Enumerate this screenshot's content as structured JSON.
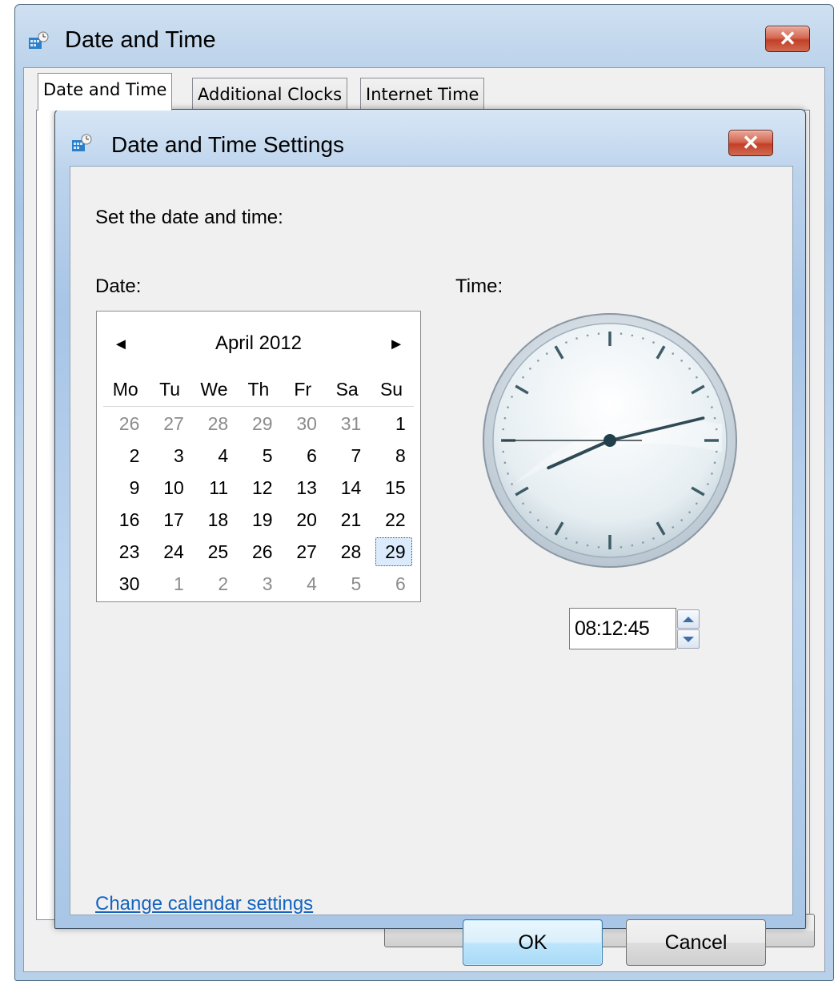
{
  "outer_window": {
    "title": "Date and Time",
    "tabs": [
      "Date and Time",
      "Additional Clocks",
      "Internet Time"
    ]
  },
  "dialog": {
    "title": "Date and Time Settings",
    "prompt": "Set the date and time:",
    "date_label": "Date:",
    "time_label": "Time:",
    "calendar": {
      "month_year": "April 2012",
      "prev_arrow": "◄",
      "next_arrow": "►",
      "weekdays": [
        "Mo",
        "Tu",
        "We",
        "Th",
        "Fr",
        "Sa",
        "Su"
      ],
      "days": [
        {
          "d": "26",
          "other": true
        },
        {
          "d": "27",
          "other": true
        },
        {
          "d": "28",
          "other": true
        },
        {
          "d": "29",
          "other": true
        },
        {
          "d": "30",
          "other": true
        },
        {
          "d": "31",
          "other": true
        },
        {
          "d": "1"
        },
        {
          "d": "2"
        },
        {
          "d": "3"
        },
        {
          "d": "4"
        },
        {
          "d": "5"
        },
        {
          "d": "6"
        },
        {
          "d": "7"
        },
        {
          "d": "8"
        },
        {
          "d": "9"
        },
        {
          "d": "10"
        },
        {
          "d": "11"
        },
        {
          "d": "12"
        },
        {
          "d": "13"
        },
        {
          "d": "14"
        },
        {
          "d": "15"
        },
        {
          "d": "16"
        },
        {
          "d": "17"
        },
        {
          "d": "18"
        },
        {
          "d": "19"
        },
        {
          "d": "20"
        },
        {
          "d": "21"
        },
        {
          "d": "22"
        },
        {
          "d": "23"
        },
        {
          "d": "24"
        },
        {
          "d": "25"
        },
        {
          "d": "26"
        },
        {
          "d": "27"
        },
        {
          "d": "28"
        },
        {
          "d": "29",
          "selected": true
        },
        {
          "d": "30"
        },
        {
          "d": "1",
          "other": true
        },
        {
          "d": "2",
          "other": true
        },
        {
          "d": "3",
          "other": true
        },
        {
          "d": "4",
          "other": true
        },
        {
          "d": "5",
          "other": true
        },
        {
          "d": "6",
          "other": true
        }
      ]
    },
    "clock": {
      "hours": 8,
      "minutes": 12,
      "seconds": 45
    },
    "time_value": "08:12:45",
    "change_calendar_link": "Change calendar settings",
    "ok_label": "OK",
    "cancel_label": "Cancel"
  },
  "colors": {
    "link": "#1565c0",
    "selected_day_bg": "#dcebfc",
    "close_button": "#c94a33",
    "window_frame": "#b9d1ea"
  },
  "icons": {
    "title": "date-time-icon",
    "close": "close-icon",
    "spin_up": "spin-up-icon",
    "spin_down": "spin-down-icon"
  }
}
